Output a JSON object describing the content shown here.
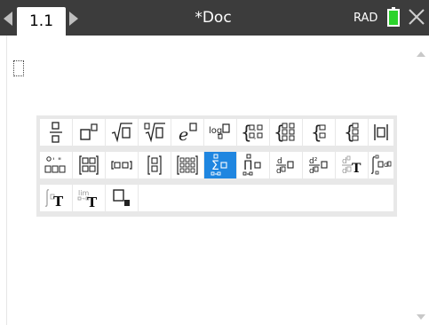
{
  "tab": {
    "label": "1.1"
  },
  "document": {
    "title": "*Doc"
  },
  "status": {
    "angle_mode": "RAD",
    "battery_color": "#2bd32b"
  },
  "palette": {
    "selected": "sum-template",
    "rows": [
      [
        "fraction-template",
        "exponent-template",
        "square-root-template",
        "nth-root-template",
        "e-exponent-template",
        "log-template",
        "piecewise-2-template",
        "piecewise-n-template",
        "system-2-template",
        "system-n-template",
        "absolute-value-template"
      ],
      [
        "degree-minute-second-template",
        "matrix-2x2-template",
        "row-matrix-template",
        "column-matrix-template",
        "matrix-mxn-template",
        "sum-template",
        "product-template",
        "derivative-template",
        "second-derivative-template",
        "nth-derivative-template",
        "definite-integral-template"
      ],
      [
        "indefinite-integral-template",
        "limit-template",
        "subscript-template"
      ]
    ]
  }
}
